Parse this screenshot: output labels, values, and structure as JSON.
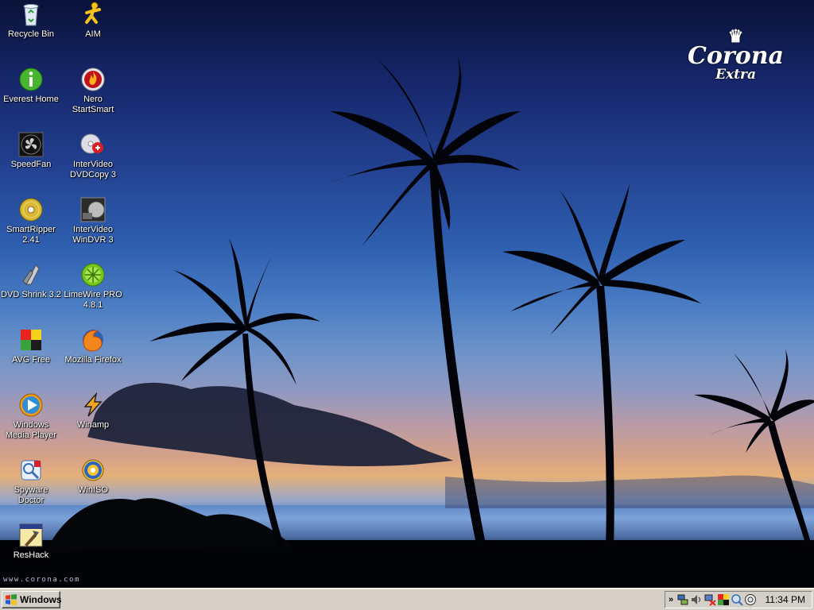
{
  "brand": {
    "name": "Corona",
    "sub": "Extra"
  },
  "watermark": "www.corona.com",
  "desktop_icons": [
    {
      "label": "Recycle Bin",
      "icon": "recycle-bin-icon"
    },
    {
      "label": "AIM",
      "icon": "aim-running-man-icon"
    },
    {
      "label": "Everest Home",
      "icon": "everest-info-icon"
    },
    {
      "label": "Nero\nStartSmart",
      "icon": "nero-flame-icon"
    },
    {
      "label": "SpeedFan",
      "icon": "speedfan-fan-icon"
    },
    {
      "label": "InterVideo\nDVDCopy 3",
      "icon": "dvd-copy-icon"
    },
    {
      "label": "SmartRipper\n2.41",
      "icon": "disc-gold-icon"
    },
    {
      "label": "InterVideo\nWinDVR 3",
      "icon": "windvr-icon"
    },
    {
      "label": "DVD Shrink 3.2",
      "icon": "dvd-shrink-icon"
    },
    {
      "label": "LimeWire PRO\n4.8.1",
      "icon": "limewire-icon"
    },
    {
      "label": "AVG Free",
      "icon": "avg-icon"
    },
    {
      "label": "Mozilla Firefox",
      "icon": "firefox-icon"
    },
    {
      "label": "Windows\nMedia Player",
      "icon": "media-player-icon"
    },
    {
      "label": "Winamp",
      "icon": "winamp-icon"
    },
    {
      "label": "Spyware\nDoctor",
      "icon": "spyware-doctor-icon"
    },
    {
      "label": "WinISO",
      "icon": "winiso-icon"
    },
    {
      "label": "ResHack",
      "icon": "reshack-icon"
    }
  ],
  "taskbar": {
    "start_label": "Windows",
    "clock": "11:34 PM",
    "tray_icons": [
      "network-icon",
      "volume-icon",
      "network-disconnected-icon",
      "avg-tray-icon",
      "spyware-tray-icon",
      "limewire-tray-icon"
    ]
  },
  "colors": {
    "taskbar": "#d4d0c8",
    "sky_top": "#0a1238",
    "sky_mid": "#2f5fb0",
    "horizon": "#e5b07a"
  }
}
